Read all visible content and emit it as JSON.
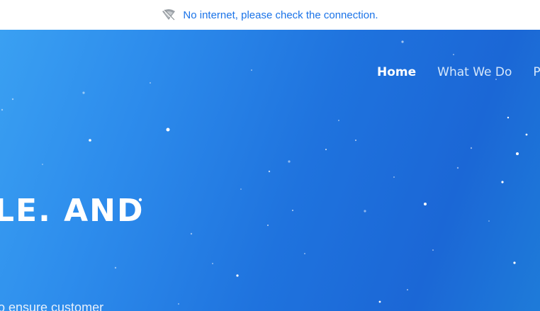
{
  "offline_banner": {
    "icon": "wifi-off-icon",
    "message": "No internet, please check the connection."
  },
  "nav": {
    "items": [
      {
        "label": "Home",
        "active": true
      },
      {
        "label": "What We Do",
        "active": false
      },
      {
        "label": "Pro",
        "active": false
      }
    ]
  },
  "hero": {
    "headline": "LE. AND",
    "subtext": "o ensure customer"
  },
  "colors": {
    "link_blue": "#1a73e8",
    "hero_gradient_start": "#3aa0f2",
    "hero_gradient_end": "#1b67d6"
  }
}
